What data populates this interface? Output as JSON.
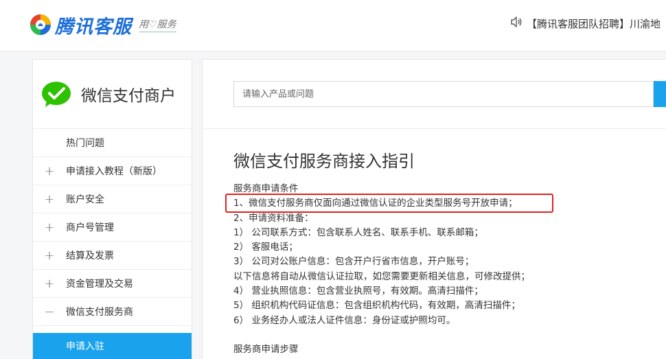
{
  "header": {
    "logo_title": "腾讯客服",
    "logo_slogan": "用♡服务",
    "announcement": "【腾讯客服团队招聘】川渝地"
  },
  "sidebar": {
    "brand_title": "微信支付商户",
    "items": [
      {
        "label": "热门问题",
        "sign": ""
      },
      {
        "label": "申请接入教程（新版）",
        "sign": "+"
      },
      {
        "label": "账户安全",
        "sign": "+"
      },
      {
        "label": "商户号管理",
        "sign": "+"
      },
      {
        "label": "结算及发票",
        "sign": "+"
      },
      {
        "label": "资金管理及交易",
        "sign": "+"
      },
      {
        "label": "微信支付服务商",
        "sign": "−"
      }
    ],
    "active_subitem": "申请入驻"
  },
  "main": {
    "search_placeholder": "请输入产品或问题",
    "article_title": "微信支付服务商接入指引",
    "lines": [
      "服务商申请条件",
      "1、微信支付服务商仅面向通过微信认证的企业类型服务号开放申请；",
      "2、申请资料准备：",
      "1） 公司联系方式：包含联系人姓名、联系手机、联系邮箱；",
      "2） 客服电话；",
      "3） 公司对公账户信息：包含开户行省市信息，开户账号；",
      "以下信息将自动从微信认证拉取，如您需要更新相关信息，可修改提供；",
      "4） 营业执照信息：包含营业执照号，有效期。高清扫描件；",
      "5） 组织机构代码证信息：包含组织机构代码，有效期，高清扫描件；",
      "6） 业务经办人或法人证件信息：身份证或护照均可。"
    ],
    "section2_heading": "服务商申请步骤"
  },
  "colors": {
    "accent": "#1aa3ec",
    "highlight": "#e02020",
    "wechat_green": "#2dc100"
  }
}
